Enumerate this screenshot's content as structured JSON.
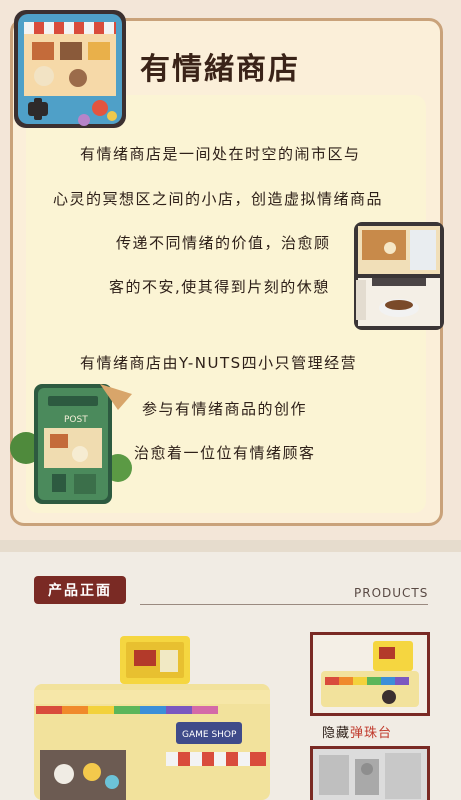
{
  "title": "有情緒商店",
  "description": {
    "line1": "有情绪商店是一间处在时空的闹市区与",
    "line2": "心灵的冥想区之间的小店，创造虚拟情绪商品",
    "line3": "传递不同情绪的价值，治愈顾",
    "line4": "客的不安,使其得到片刻的休憩",
    "line5": "有情绪商店由Y-NUTS四小只管理经营",
    "line6": "参与有情绪商品的创作",
    "line7": "治愈着一位位有情绪顾客"
  },
  "illustrations": {
    "postbox_label": "POST",
    "game_shop_sign": "GAME SHOP"
  },
  "section": {
    "tab_label": "产品正面",
    "en_label": "PRODUCTS"
  },
  "detail": {
    "caption_prefix": "隐藏",
    "caption_highlight": "弹珠台"
  },
  "colors": {
    "accent": "#7a2a24",
    "highlight": "#c0392b",
    "card_border": "#c9a27a"
  }
}
